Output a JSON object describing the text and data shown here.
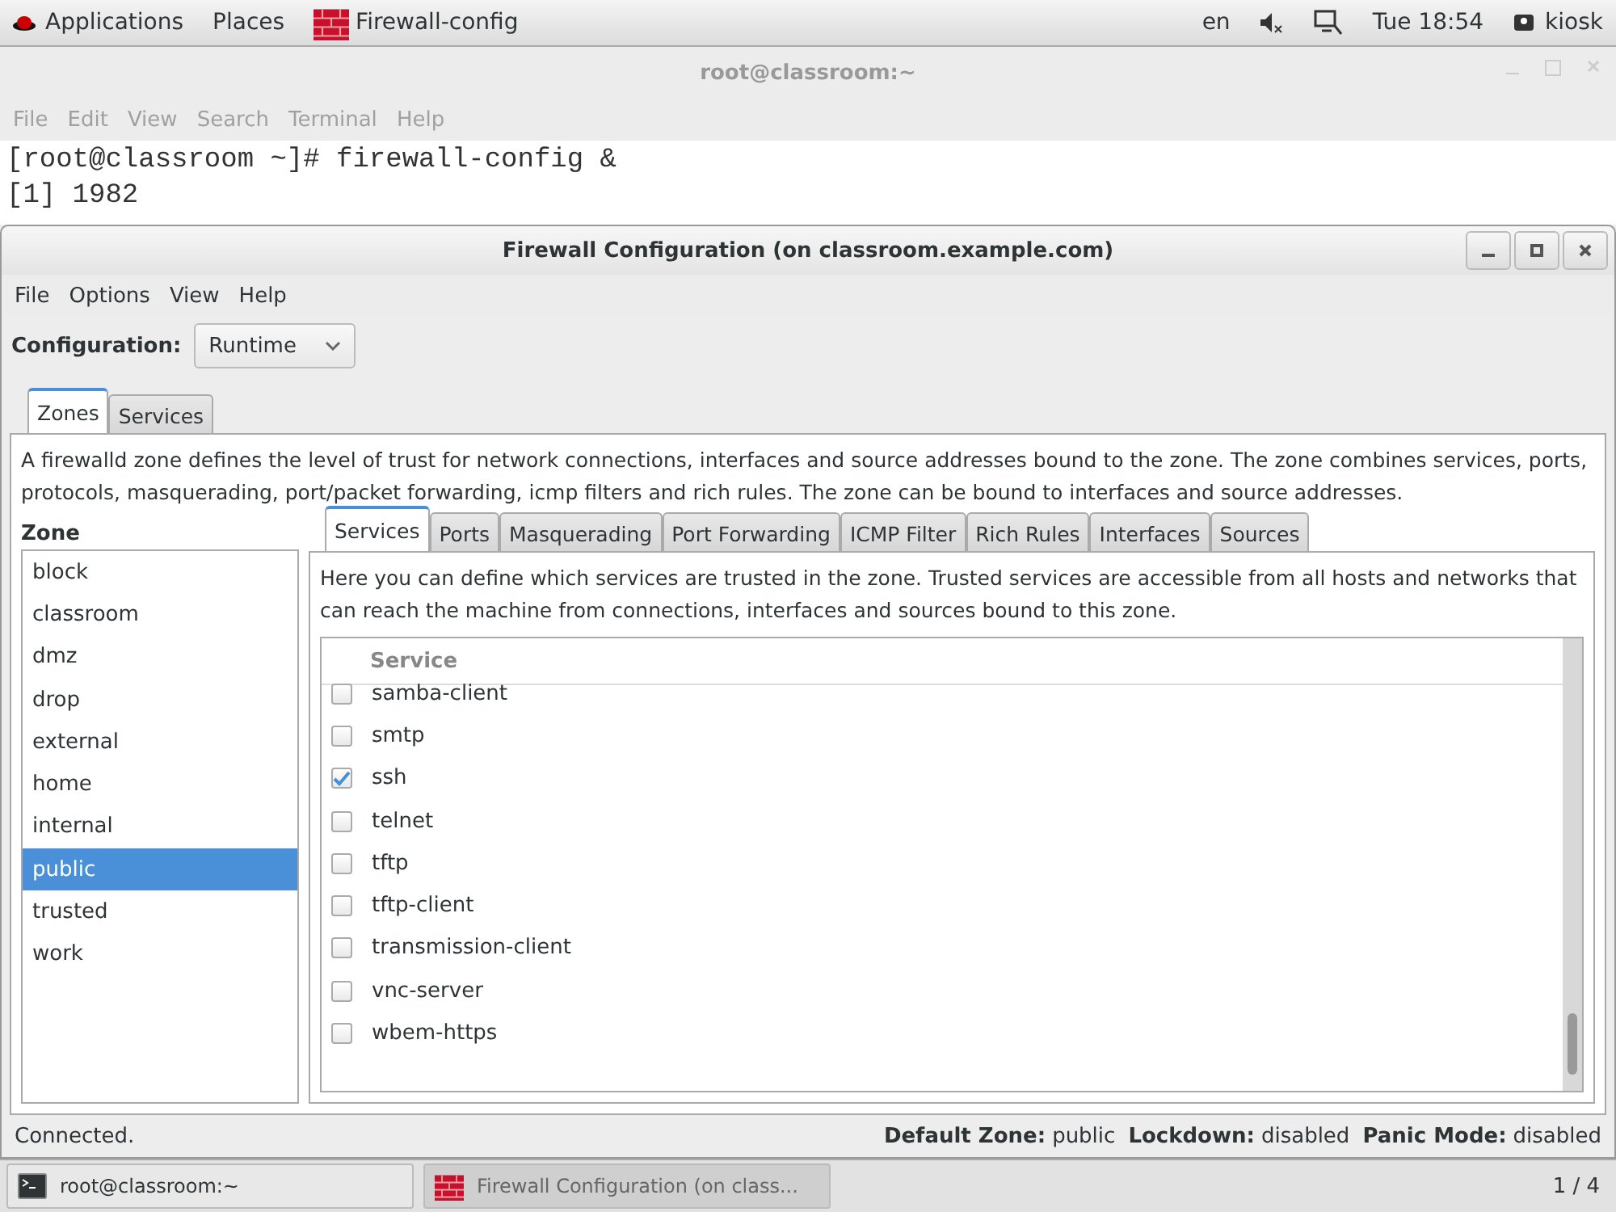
{
  "top_bar": {
    "menus": [
      "Applications",
      "Places"
    ],
    "app": "Firewall-config",
    "lang": "en",
    "clock": "Tue 18:54",
    "user": "kiosk"
  },
  "terminal": {
    "title": "root@classroom:~",
    "menu": [
      "File",
      "Edit",
      "View",
      "Search",
      "Terminal",
      "Help"
    ],
    "lines": [
      "[root@classroom ~]# firewall-config &",
      "[1] 1982"
    ]
  },
  "firewall": {
    "title": "Firewall Configuration (on classroom.example.com)",
    "menu": [
      "File",
      "Options",
      "View",
      "Help"
    ],
    "configuration": {
      "label": "Configuration:",
      "value": "Runtime"
    },
    "tabs": [
      {
        "label": "Zones",
        "selected": true
      },
      {
        "label": "Services",
        "selected": false
      }
    ],
    "description": "A firewalld zone defines the level of trust for network connections, interfaces and source addresses bound to the zone. The zone combines services, ports, protocols, masquerading, port/packet forwarding, icmp filters and rich rules. The zone can be bound to interfaces and source addresses.",
    "zone_heading": "Zone",
    "zones": [
      {
        "name": "block",
        "selected": false
      },
      {
        "name": "classroom",
        "selected": false
      },
      {
        "name": "dmz",
        "selected": false
      },
      {
        "name": "drop",
        "selected": false
      },
      {
        "name": "external",
        "selected": false
      },
      {
        "name": "home",
        "selected": false
      },
      {
        "name": "internal",
        "selected": false
      },
      {
        "name": "public",
        "selected": true
      },
      {
        "name": "trusted",
        "selected": false
      },
      {
        "name": "work",
        "selected": false
      }
    ],
    "zone_tabs": [
      {
        "label": "Services",
        "selected": true
      },
      {
        "label": "Ports",
        "selected": false
      },
      {
        "label": "Masquerading",
        "selected": false
      },
      {
        "label": "Port Forwarding",
        "selected": false
      },
      {
        "label": "ICMP Filter",
        "selected": false
      },
      {
        "label": "Rich Rules",
        "selected": false
      },
      {
        "label": "Interfaces",
        "selected": false
      },
      {
        "label": "Sources",
        "selected": false
      }
    ],
    "services_description": "Here you can define which services are trusted in the zone. Trusted services are accessible from all hosts and networks that can reach the machine from connections, interfaces and sources bound to this zone.",
    "services_column": "Service",
    "services": [
      {
        "name": "samba-client",
        "checked": false
      },
      {
        "name": "smtp",
        "checked": false
      },
      {
        "name": "ssh",
        "checked": true
      },
      {
        "name": "telnet",
        "checked": false
      },
      {
        "name": "tftp",
        "checked": false
      },
      {
        "name": "tftp-client",
        "checked": false
      },
      {
        "name": "transmission-client",
        "checked": false
      },
      {
        "name": "vnc-server",
        "checked": false
      },
      {
        "name": "wbem-https",
        "checked": false
      }
    ],
    "status": {
      "connected": "Connected.",
      "fields": [
        {
          "label": "Default Zone:",
          "value": "public"
        },
        {
          "label": "Lockdown:",
          "value": "disabled"
        },
        {
          "label": "Panic Mode:",
          "value": "disabled"
        }
      ]
    }
  },
  "taskbar": {
    "tasks": [
      {
        "label": "root@classroom:~",
        "selected": false
      },
      {
        "label": "Firewall Configuration (on class...",
        "selected": true
      }
    ],
    "workspace": "1 / 4"
  }
}
